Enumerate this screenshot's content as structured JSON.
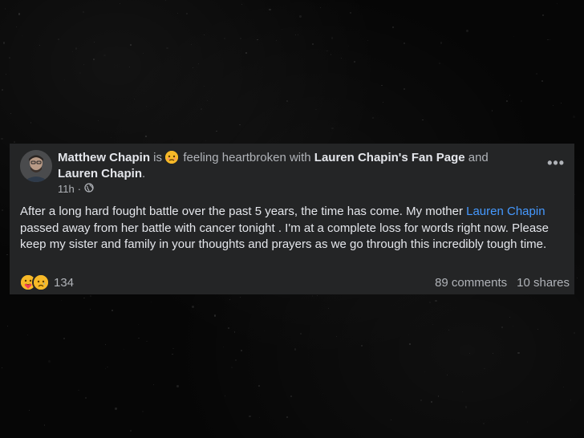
{
  "post": {
    "author": "Matthew Chapin",
    "is_text": "is",
    "feeling_text": "feeling heartbroken with",
    "tag_page": "Lauren Chapin's Fan Page",
    "and_text": "and",
    "tag_person": "Lauren Chapin",
    "period": ".",
    "time": "11h",
    "separator": "·",
    "privacy_icon": "globe-icon",
    "more_label": "•••",
    "body_part1": "After a long hard fought battle over the past 5 years, the time has come. My mother ",
    "body_link": "Lauren Chapin",
    "body_part2": " passed away from her battle with cancer tonight . I'm at a complete loss for words right now. Please keep my sister and family in your thoughts and prayers as we go through this incredibly tough time.",
    "reaction_icons": [
      "care-reaction-icon",
      "sad-reaction-icon"
    ],
    "reaction_count": "134",
    "comments": "89 comments",
    "shares": "10 shares"
  },
  "colors": {
    "background": "#070707",
    "card": "#242526",
    "text_primary": "#e4e6eb",
    "text_secondary": "#b0b3b8",
    "link": "#4599ff",
    "emoji_yellow": "#f7b928"
  }
}
